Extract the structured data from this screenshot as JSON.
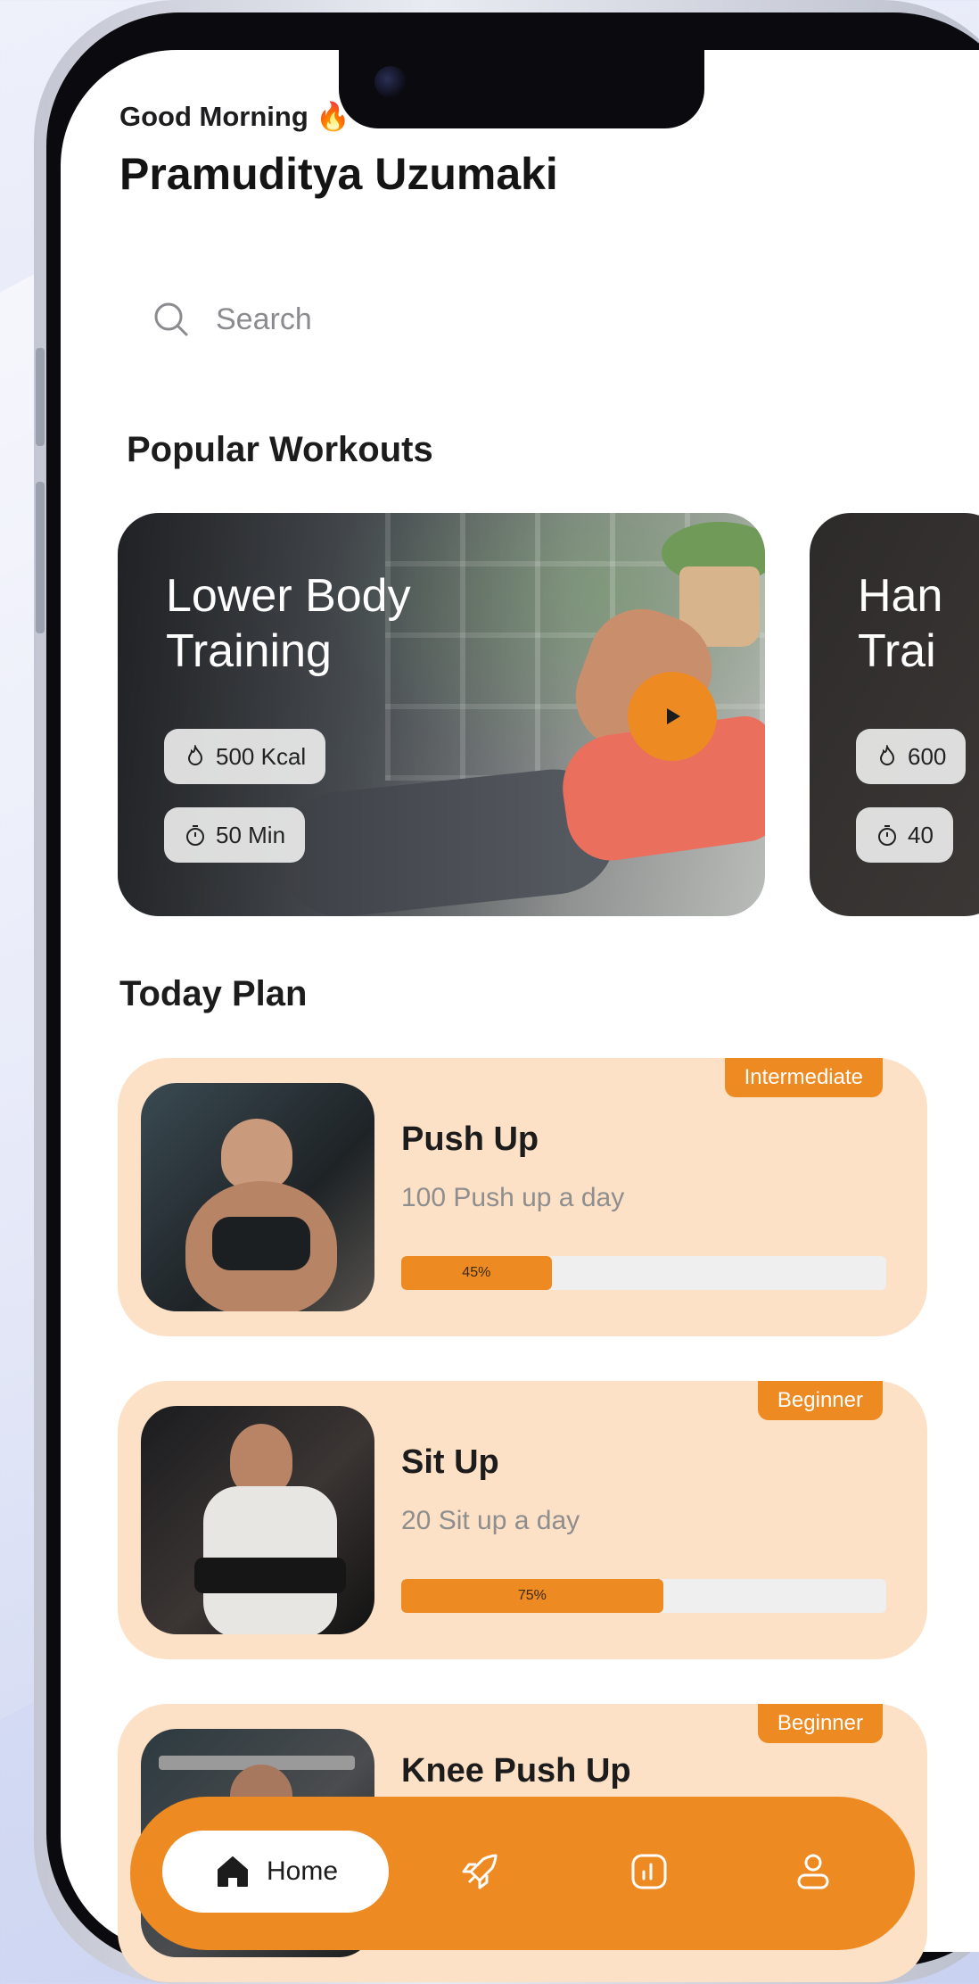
{
  "header": {
    "greeting": "Good Morning",
    "greeting_emoji": "🔥",
    "user_name": "Pramuditya Uzumaki"
  },
  "search": {
    "placeholder": "Search"
  },
  "popular": {
    "title": "Popular Workouts",
    "cards": [
      {
        "title_line1": "Lower Body",
        "title_line2": "Training",
        "kcal": "500 Kcal",
        "duration": "50 Min"
      },
      {
        "title_line1": "Han",
        "title_line2": "Trai",
        "kcal": "600",
        "duration": "40"
      }
    ]
  },
  "today": {
    "title": "Today Plan",
    "items": [
      {
        "title": "Push Up",
        "subtitle": "100 Push up a day",
        "level": "Intermediate",
        "progress_label": "45%",
        "progress": 0.31
      },
      {
        "title": "Sit Up",
        "subtitle": "20 Sit up a day",
        "level": "Beginner",
        "progress_label": "75%",
        "progress": 0.54
      },
      {
        "title": "Knee Push Up",
        "subtitle": "",
        "level": "Beginner",
        "progress_label": "",
        "progress": 0
      }
    ]
  },
  "nav": {
    "home_label": "Home",
    "items": [
      "home-icon",
      "rocket-icon",
      "chart-icon",
      "profile-icon"
    ]
  },
  "colors": {
    "accent": "#ee8a22",
    "plan_card_bg": "#fde1c6"
  }
}
